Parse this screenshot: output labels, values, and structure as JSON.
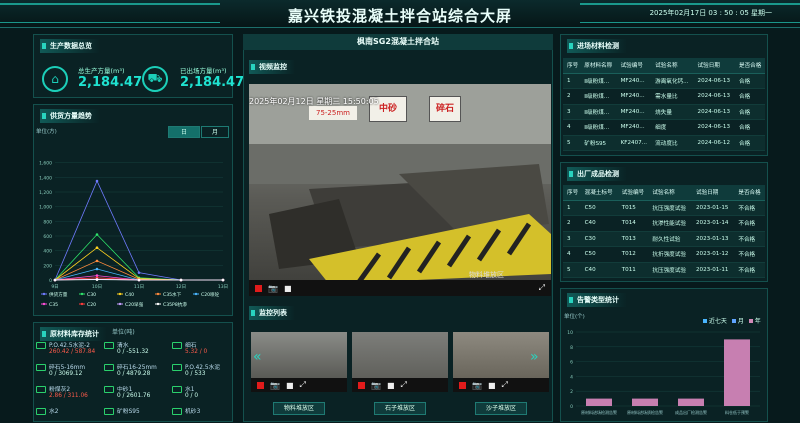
{
  "header": {
    "title": "嘉兴铁投混凝土拌合站综合大屏",
    "datetime": "2025年02月17日 03 : 50 : 05  星期一"
  },
  "production": {
    "title": "生产数据总览",
    "total_label": "总生产方量(m³)",
    "total_value": "2,184.47",
    "out_label": "已出场方量(m³)",
    "out_value": "2,184.47"
  },
  "supply": {
    "title": "供货方量趋势",
    "unit": "单位(方)",
    "tab_day": "日",
    "tab_month": "月"
  },
  "chart_data": {
    "type": "line",
    "x": [
      "9日",
      "10日",
      "11日",
      "12日",
      "13日"
    ],
    "ylim": [
      0,
      1800
    ],
    "yticks": [
      0,
      200,
      400,
      600,
      800,
      1000,
      1200,
      1400,
      1600
    ],
    "series": [
      {
        "name": "供货方量",
        "color": "#6f7bff",
        "values": [
          0,
          1350,
          100,
          0,
          0
        ]
      },
      {
        "name": "C30",
        "color": "#2ee36a",
        "values": [
          0,
          620,
          30,
          0,
          0
        ]
      },
      {
        "name": "C40",
        "color": "#ffd21f",
        "values": [
          0,
          440,
          20,
          0,
          0
        ]
      },
      {
        "name": "C35水下",
        "color": "#ff8a3c",
        "values": [
          0,
          260,
          10,
          0,
          0
        ]
      },
      {
        "name": "C20喷砼",
        "color": "#4ab6ff",
        "values": [
          0,
          150,
          0,
          0,
          0
        ]
      },
      {
        "name": "C35",
        "color": "#ff4dd8",
        "values": [
          0,
          60,
          0,
          0,
          0
        ]
      },
      {
        "name": "C20",
        "color": "#ff3b3b",
        "values": [
          0,
          30,
          0,
          0,
          0
        ]
      },
      {
        "name": "C20早强",
        "color": "#c8a0ff",
        "values": [
          0,
          10,
          0,
          0,
          0
        ]
      },
      {
        "name": "C35P8抗渗",
        "color": "#ffffff",
        "values": [
          0,
          5,
          0,
          0,
          0
        ]
      }
    ]
  },
  "inventory": {
    "title": "原材料库存统计",
    "unit": "单位(吨)",
    "items": [
      {
        "name": "P.O.42.5水泥-2",
        "v": "260.42 / 587.84",
        "icon": "silo-icon"
      },
      {
        "name": "清水",
        "v": "0 / -551.32",
        "icon": "water-icon"
      },
      {
        "name": "细石",
        "v": "5.32 / 0",
        "icon": "truck-icon"
      },
      {
        "name": "碎石5-16mm",
        "v": "0 / 3069.12",
        "icon": "truck-icon"
      },
      {
        "name": "碎石16-25mm",
        "v": "0 / 4879.28",
        "icon": "truck-icon"
      },
      {
        "name": "P.O.42.5水泥",
        "v": "0 / 533",
        "icon": "silo-icon"
      },
      {
        "name": "粉煤灰2",
        "v": "2.86 / 311.06",
        "icon": "silo-icon"
      },
      {
        "name": "中砂1",
        "v": "0 / 2601.76",
        "icon": "truck-icon"
      },
      {
        "name": "水1",
        "v": "0 / 0",
        "icon": "water-icon"
      },
      {
        "name": "水2",
        "v": "",
        "icon": "water-icon"
      },
      {
        "name": "矿粉S95",
        "v": "",
        "icon": "silo-icon"
      },
      {
        "name": "机砂3",
        "v": "",
        "icon": "truck-icon"
      }
    ]
  },
  "center": {
    "title": "枫南SG2混凝土拌合站",
    "video_title": "视频监控",
    "video_overlay": "2025年02月12日  星期三  15:50:05",
    "video_watermark": "物料堆放区",
    "video_signs": [
      "中砂",
      "碎石",
      "75-25mm"
    ],
    "list_title": "监控列表",
    "list_labels": [
      "物料堆放区",
      "石子堆放区",
      "沙子堆放区"
    ]
  },
  "materials": {
    "title": "进场材料检测",
    "headers": [
      "序号",
      "原材料名称",
      "试验编号",
      "试验名称",
      "试验日期",
      "是否合格"
    ],
    "rows": [
      [
        "1",
        "Ⅱ级粉煤...",
        "MF240...",
        "游离氧化钙...",
        "2024-06-13",
        "合格"
      ],
      [
        "2",
        "Ⅱ级粉煤...",
        "MF240...",
        "需水量比",
        "2024-06-13",
        "合格"
      ],
      [
        "3",
        "Ⅱ级粉煤...",
        "MF240...",
        "烧失量",
        "2024-06-13",
        "合格"
      ],
      [
        "4",
        "Ⅱ级粉煤...",
        "MF240...",
        "细度",
        "2024-06-13",
        "合格"
      ],
      [
        "5",
        "矿粉S95",
        "KF2407...",
        "流动度比",
        "2024-06-12",
        "合格"
      ]
    ]
  },
  "products": {
    "title": "出厂成品检测",
    "headers": [
      "序号",
      "混凝土标号",
      "试验编号",
      "试验名称",
      "试验日期",
      "是否合格"
    ],
    "rows": [
      [
        "1",
        "C50",
        "T015",
        "抗压强度试验",
        "2023-01-15",
        "不合格"
      ],
      [
        "2",
        "C40",
        "T014",
        "抗渗性能试验",
        "2023-01-14",
        "不合格"
      ],
      [
        "3",
        "C30",
        "T013",
        "耐久性试验",
        "2023-01-13",
        "不合格"
      ],
      [
        "4",
        "C50",
        "T012",
        "抗折强度试验",
        "2023-01-12",
        "不合格"
      ],
      [
        "5",
        "C40",
        "T011",
        "抗压强度试验",
        "2023-01-11",
        "不合格"
      ]
    ]
  },
  "alarm": {
    "title": "告警类型统计",
    "unit": "单位(个)",
    "legend": [
      "近七天",
      "月",
      "年"
    ],
    "chart_data": {
      "type": "bar",
      "categories": [
        "原材料进场检测告警",
        "原材料进场质检告警",
        "成品出厂检测告警",
        "料仓低于预警"
      ],
      "values": [
        1,
        1,
        1,
        9
      ],
      "ylim": [
        0,
        10
      ],
      "yticks": [
        0,
        2,
        4,
        6,
        8,
        10
      ]
    }
  }
}
